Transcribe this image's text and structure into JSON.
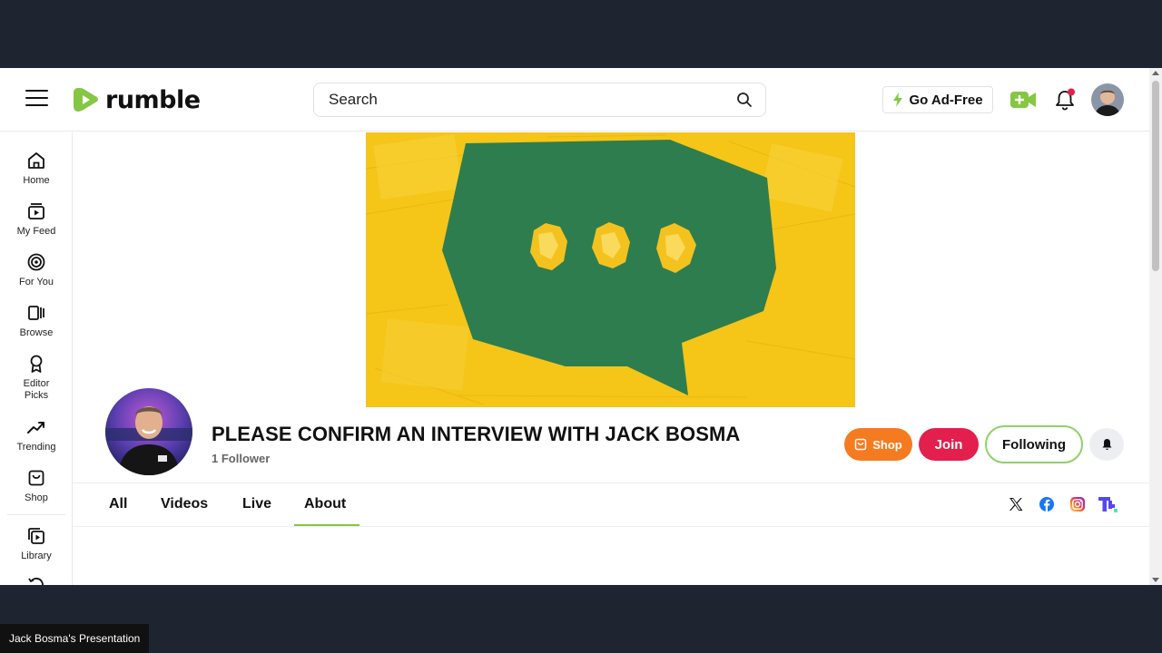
{
  "header": {
    "logo_text": "rumble",
    "search_placeholder": "Search",
    "go_adfree_label": "Go Ad-Free"
  },
  "sidebar": {
    "items": [
      {
        "label": "Home",
        "icon": "home-icon"
      },
      {
        "label": "My Feed",
        "icon": "feed-icon"
      },
      {
        "label": "For You",
        "icon": "target-icon"
      },
      {
        "label": "Browse",
        "icon": "browse-icon"
      },
      {
        "label": "Editor Picks",
        "icon": "award-icon"
      },
      {
        "label": "Trending",
        "icon": "trending-icon"
      },
      {
        "label": "Shop",
        "icon": "shop-icon"
      },
      {
        "label": "Library",
        "icon": "library-icon"
      }
    ]
  },
  "channel": {
    "title": "PLEASE CONFIRM AN INTERVIEW WITH JACK BOSMA",
    "followers": "1 Follower",
    "shop_label": "Shop",
    "join_label": "Join",
    "following_label": "Following"
  },
  "tabs": [
    {
      "label": "All"
    },
    {
      "label": "Videos"
    },
    {
      "label": "Live"
    },
    {
      "label": "About",
      "active": true
    }
  ],
  "social_icons": [
    "x-icon",
    "facebook-icon",
    "instagram-icon",
    "truth-social-icon"
  ],
  "colors": {
    "brand_green": "#85c742",
    "join_red": "#e21f4d",
    "shop_orange": "#f47b20",
    "banner_yellow": "#f5c518",
    "banner_green": "#2e7d4f"
  },
  "caption": "Jack Bosma's Presentation"
}
